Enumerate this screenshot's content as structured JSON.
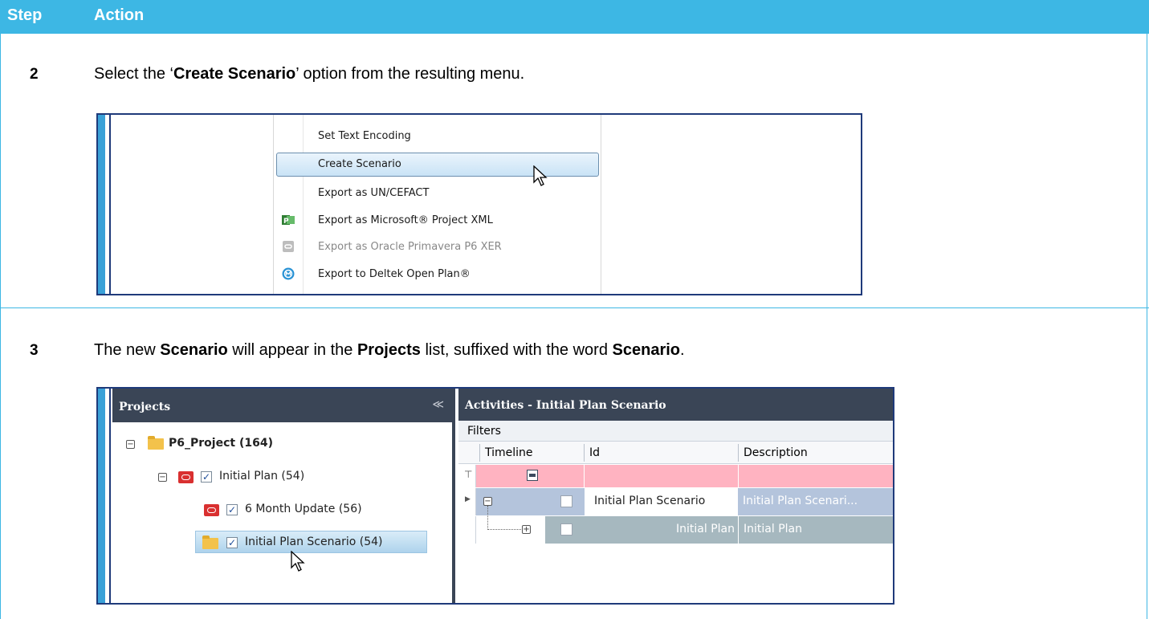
{
  "table": {
    "col_step": "Step",
    "col_action": "Action"
  },
  "step2": {
    "number": "2",
    "text_before": "Select the ‘",
    "text_bold": "Create Scenario",
    "text_after": "’ option from the resulting menu.",
    "menu": {
      "items": [
        {
          "label": "Set Text Encoding",
          "icon": "none",
          "state": "normal"
        },
        {
          "label": "Create Scenario",
          "icon": "none",
          "state": "highlighted"
        },
        {
          "label": "Export as UN/CEFACT",
          "icon": "none",
          "state": "normal"
        },
        {
          "label": "Export as Microsoft® Project XML",
          "icon": "ms-project-icon",
          "state": "normal"
        },
        {
          "label": "Export as Oracle Primavera P6 XER",
          "icon": "primavera-icon",
          "state": "disabled"
        },
        {
          "label": "Export to Deltek Open Plan®",
          "icon": "deltek-icon",
          "state": "normal"
        }
      ]
    }
  },
  "step3": {
    "number": "3",
    "t1": "The new ",
    "b1": "Scenario",
    "t2": " will appear in the ",
    "b2": "Projects",
    "t3": " list, suffixed with the word ",
    "b3": "Scenario",
    "t4": ".",
    "projects": {
      "title": "Projects",
      "collapse_glyph": "≪",
      "root": "P6_Project (164)",
      "child": "Initial  Plan (54)",
      "grandchild_1": "6 Month Update (56)",
      "grandchild_2": "Initial  Plan Scenario (54)"
    },
    "activities": {
      "title": "Activities - Initial  Plan Scenario",
      "filters": "Filters",
      "columns": [
        "Timeline",
        "Id",
        "Description"
      ],
      "rows": [
        {
          "id": "Initial  Plan Scenario",
          "description": "Initial  Plan Scenari..."
        },
        {
          "id": "Initial  Plan",
          "description": "Initial  Plan"
        }
      ]
    }
  },
  "colors": {
    "accent": "#3db7e4",
    "pane_header": "#3a4556",
    "filter_row": "#ffb3c1"
  }
}
